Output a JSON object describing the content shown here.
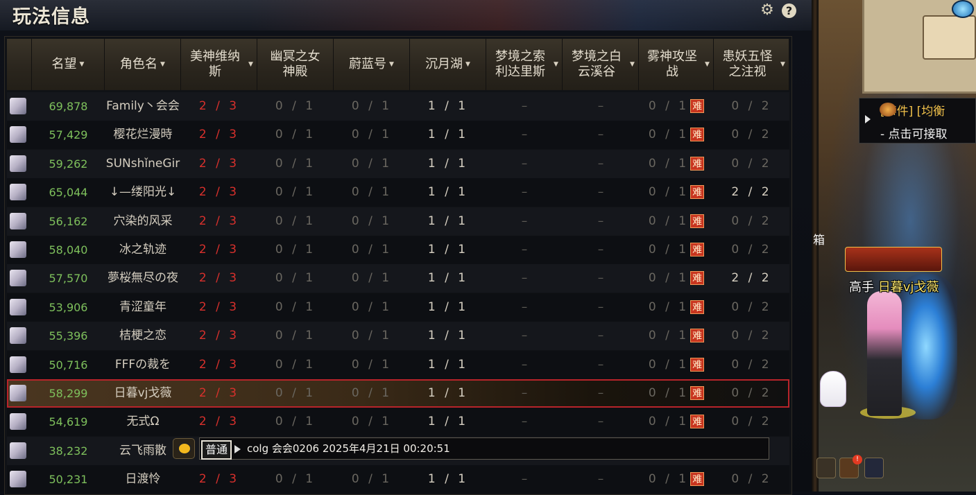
{
  "panel": {
    "title": "玩法信息"
  },
  "header": {
    "columns": [
      {
        "label": "名望",
        "sortable": true
      },
      {
        "label": "角色名",
        "sortable": true
      },
      {
        "label": "美神维纳斯",
        "sortable": true
      },
      {
        "label": "幽冥之女神殿",
        "sortable": false
      },
      {
        "label": "蔚蓝号",
        "sortable": true
      },
      {
        "label": "沉月湖",
        "sortable": true
      },
      {
        "label": "梦境之索利达里斯",
        "sortable": true
      },
      {
        "label": "梦境之白云溪谷",
        "sortable": true
      },
      {
        "label": "雾神攻坚战",
        "sortable": true
      },
      {
        "label": "患妖五怪之注视",
        "sortable": true
      }
    ]
  },
  "rows": [
    {
      "fame": "69,878",
      "name": "Family丶会会",
      "venus": "2 / 3",
      "netherworld": "0 / 1",
      "azure": "0 / 1",
      "moonlake": "1 / 1",
      "solidaris": "–",
      "cloud": "–",
      "fog": "0 / 1",
      "fog_badge": "难",
      "monster": "0 / 2"
    },
    {
      "fame": "57,429",
      "name": "樱花烂漫時",
      "venus": "2 / 3",
      "netherworld": "0 / 1",
      "azure": "0 / 1",
      "moonlake": "1 / 1",
      "solidaris": "–",
      "cloud": "–",
      "fog": "0 / 1",
      "fog_badge": "难",
      "monster": "0 / 2"
    },
    {
      "fame": "59,262",
      "name": "SUNshǐneGir",
      "venus": "2 / 3",
      "netherworld": "0 / 1",
      "azure": "0 / 1",
      "moonlake": "1 / 1",
      "solidaris": "–",
      "cloud": "–",
      "fog": "0 / 1",
      "fog_badge": "难",
      "monster": "0 / 2"
    },
    {
      "fame": "65,044",
      "name": "↓—缕阳光↓",
      "venus": "2 / 3",
      "netherworld": "0 / 1",
      "azure": "0 / 1",
      "moonlake": "1 / 1",
      "solidaris": "–",
      "cloud": "–",
      "fog": "0 / 1",
      "fog_badge": "难",
      "monster": "2 / 2"
    },
    {
      "fame": "56,162",
      "name": "穴染的风采",
      "venus": "2 / 3",
      "netherworld": "0 / 1",
      "azure": "0 / 1",
      "moonlake": "1 / 1",
      "solidaris": "–",
      "cloud": "–",
      "fog": "0 / 1",
      "fog_badge": "难",
      "monster": "0 / 2"
    },
    {
      "fame": "58,040",
      "name": "冰之轨迹",
      "venus": "2 / 3",
      "netherworld": "0 / 1",
      "azure": "0 / 1",
      "moonlake": "1 / 1",
      "solidaris": "–",
      "cloud": "–",
      "fog": "0 / 1",
      "fog_badge": "难",
      "monster": "0 / 2"
    },
    {
      "fame": "57,570",
      "name": "夢桜無尽の夜",
      "venus": "2 / 3",
      "netherworld": "0 / 1",
      "azure": "0 / 1",
      "moonlake": "1 / 1",
      "solidaris": "–",
      "cloud": "–",
      "fog": "0 / 1",
      "fog_badge": "难",
      "monster": "2 / 2"
    },
    {
      "fame": "53,906",
      "name": "青涩童年",
      "venus": "2 / 3",
      "netherworld": "0 / 1",
      "azure": "0 / 1",
      "moonlake": "1 / 1",
      "solidaris": "–",
      "cloud": "–",
      "fog": "0 / 1",
      "fog_badge": "难",
      "monster": "0 / 2"
    },
    {
      "fame": "55,396",
      "name": "桔梗之恋",
      "venus": "2 / 3",
      "netherworld": "0 / 1",
      "azure": "0 / 1",
      "moonlake": "1 / 1",
      "solidaris": "–",
      "cloud": "–",
      "fog": "0 / 1",
      "fog_badge": "难",
      "monster": "0 / 2"
    },
    {
      "fame": "50,716",
      "name": "FFFの裁を",
      "venus": "2 / 3",
      "netherworld": "0 / 1",
      "azure": "0 / 1",
      "moonlake": "1 / 1",
      "solidaris": "–",
      "cloud": "–",
      "fog": "0 / 1",
      "fog_badge": "难",
      "monster": "0 / 2"
    },
    {
      "fame": "58,299",
      "name": "日暮vj戈薇",
      "venus": "2 / 3",
      "netherworld": "0 / 1",
      "azure": "0 / 1",
      "moonlake": "1 / 1",
      "solidaris": "–",
      "cloud": "–",
      "fog": "0 / 1",
      "fog_badge": "难",
      "monster": "0 / 2",
      "selected": true
    },
    {
      "fame": "54,619",
      "name": "无式Ω",
      "venus": "2 / 3",
      "netherworld": "0 / 1",
      "azure": "0 / 1",
      "moonlake": "1 / 1",
      "solidaris": "–",
      "cloud": "–",
      "fog": "0 / 1",
      "fog_badge": "难",
      "monster": "0 / 2"
    },
    {
      "fame": "38,232",
      "name": "云飞雨散",
      "venus": "",
      "netherworld": "",
      "azure": "",
      "moonlake": "",
      "solidaris": "",
      "cloud": "",
      "fog": "",
      "fog_badge": "",
      "monster": ""
    },
    {
      "fame": "50,231",
      "name": "日渡怜",
      "venus": "2 / 3",
      "netherworld": "0 / 1",
      "azure": "0 / 1",
      "moonlake": "1 / 1",
      "solidaris": "–",
      "cloud": "–",
      "fog": "0 / 1",
      "fog_badge": "难",
      "monster": "0 / 2"
    }
  ],
  "chat": {
    "channel": "普通",
    "message": "colg 会会0206  2025年4月21日 00:20:51"
  },
  "game": {
    "event_title": "[事件] [均衡",
    "event_sub": "- 点击可接取",
    "side_label": "箱",
    "player_prefix": "高手 ",
    "player_name": "日暮vj戈薇"
  },
  "colors": {
    "accent_red": "#d8302c",
    "fame_green": "#7ec05c",
    "selected_border": "#b8242a",
    "badge": "#c8351f"
  },
  "icons": [
    "gear-icon",
    "help-icon",
    "sort-arrow-icon",
    "avatar-icon",
    "hard-badge-icon",
    "emote-icon",
    "play-icon",
    "event-icon",
    "orb-icon"
  ]
}
